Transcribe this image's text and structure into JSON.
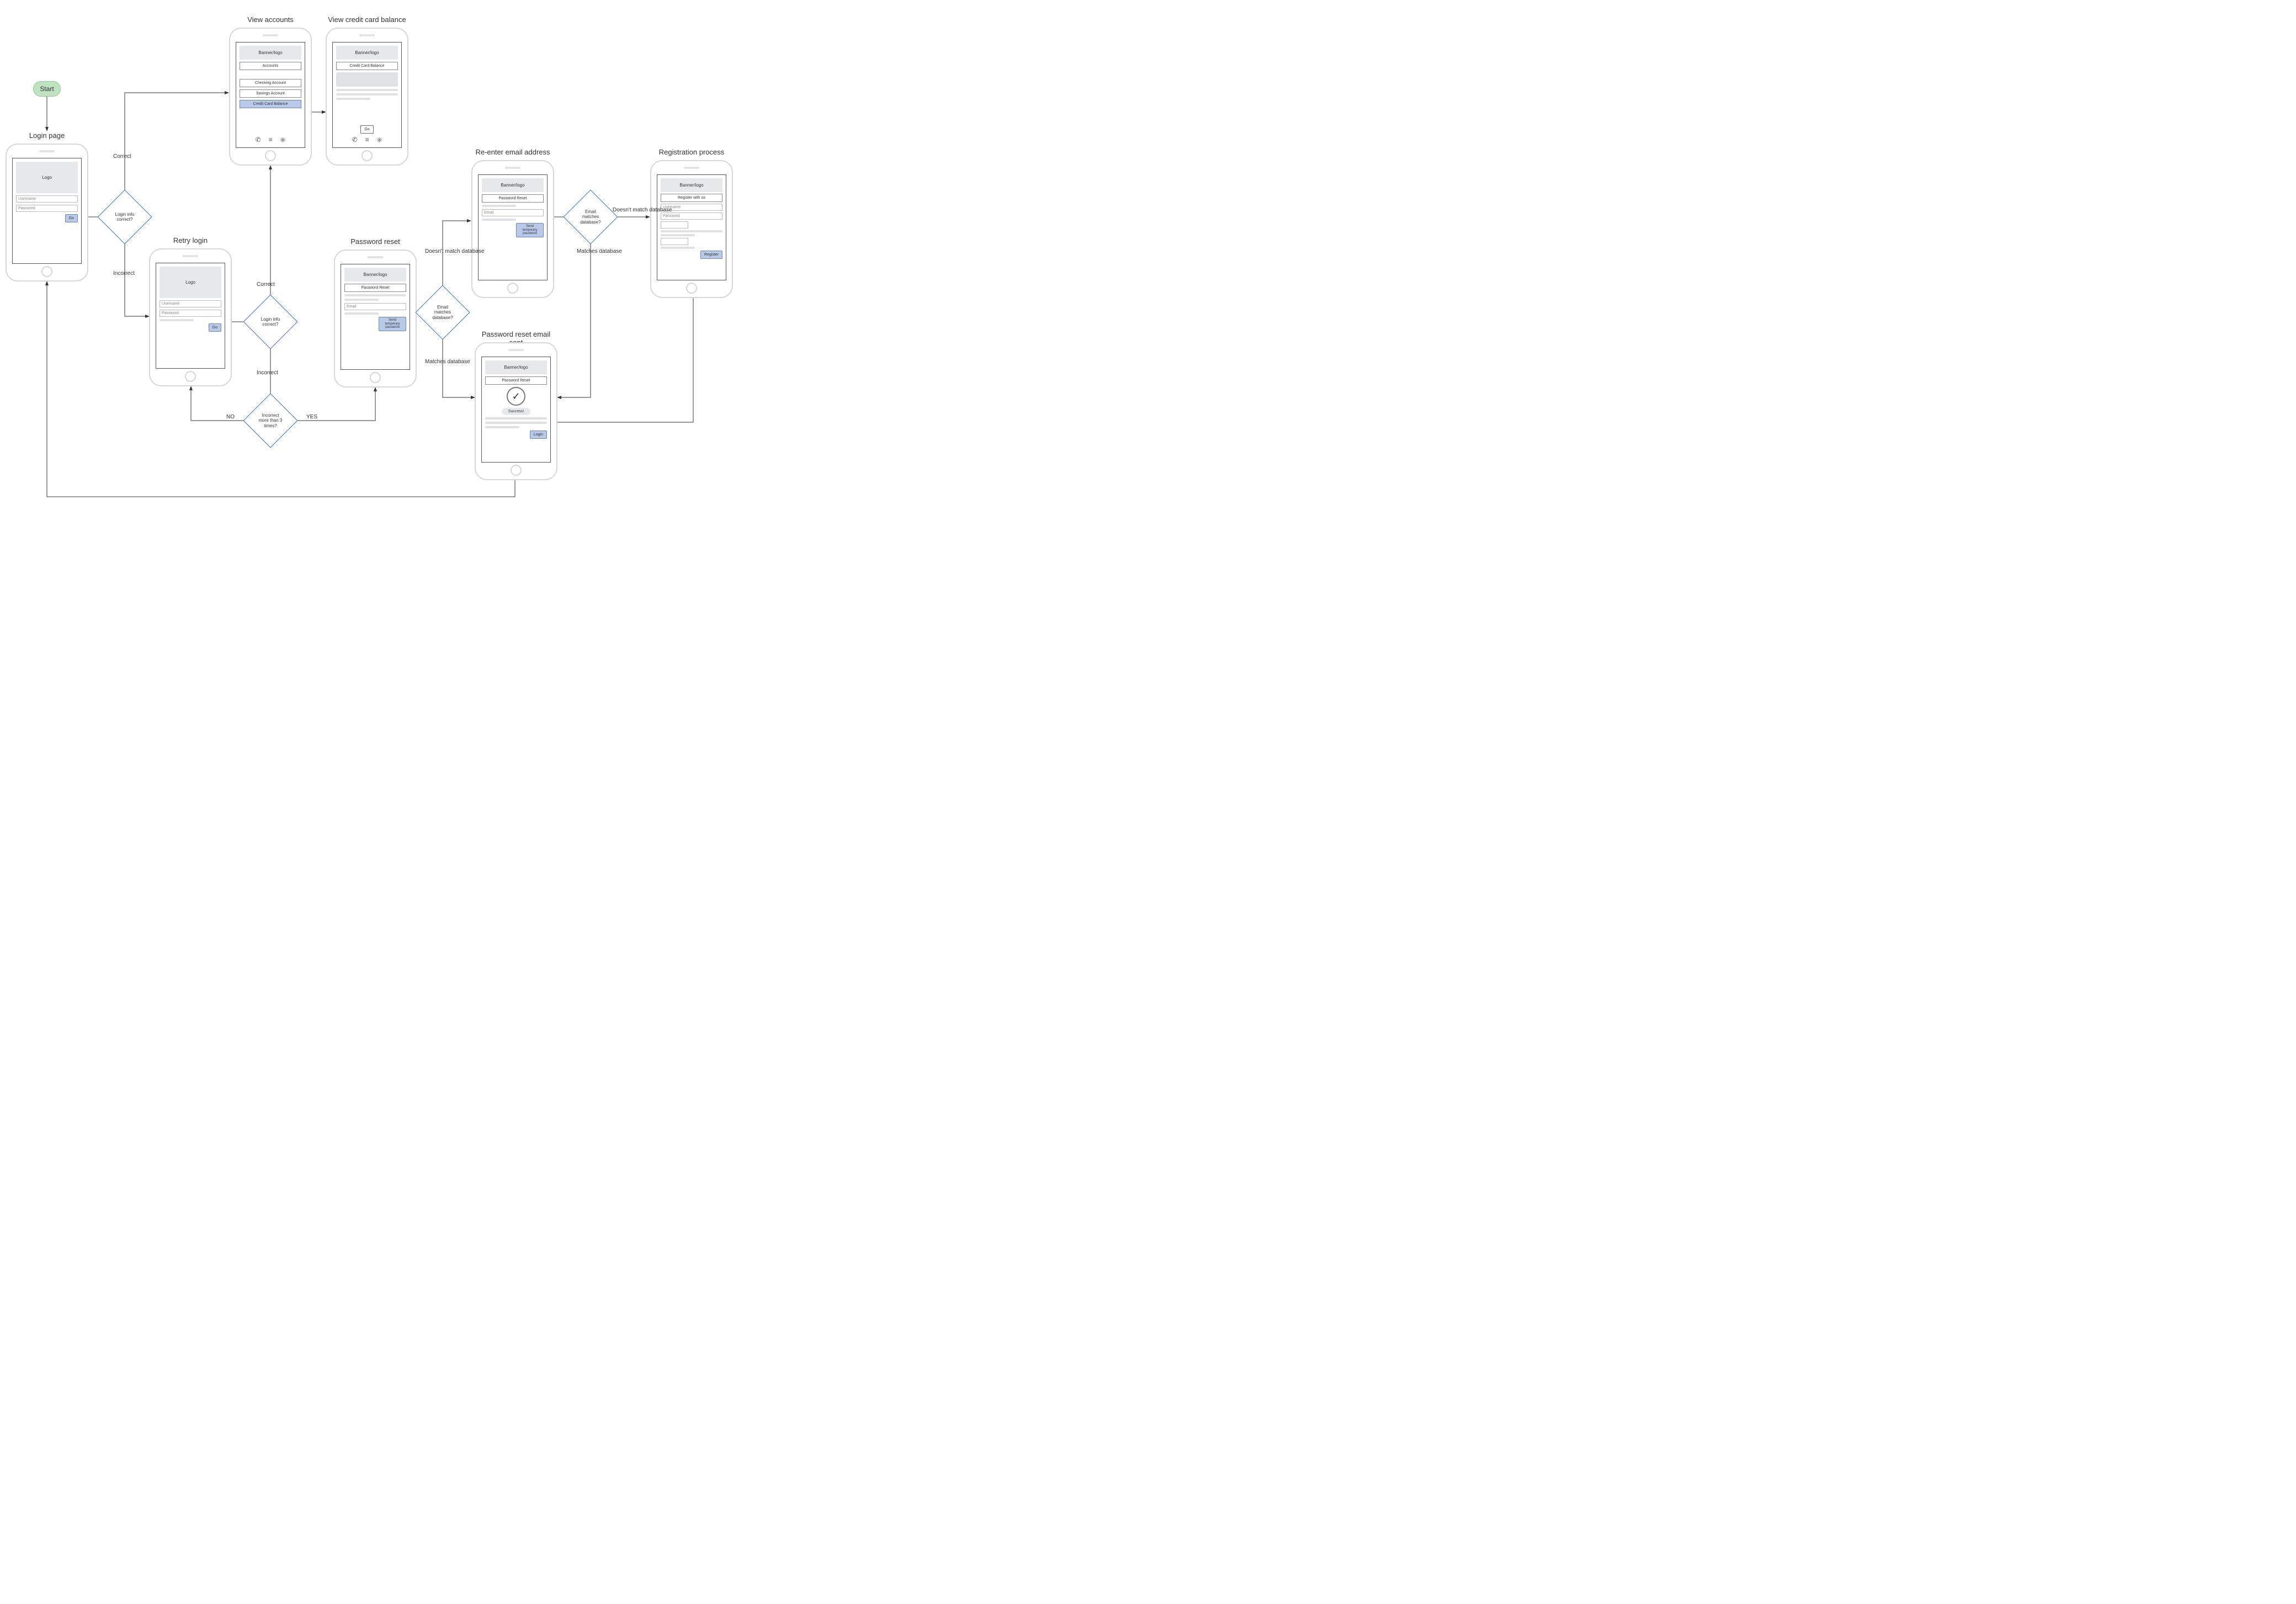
{
  "start": {
    "label": "Start"
  },
  "screens": {
    "login": {
      "title": "Login page",
      "logo": "Logo",
      "username_ph": "Username",
      "password_ph": "Password",
      "go": "Go"
    },
    "retry": {
      "title": "Retry login",
      "logo": "Logo",
      "username_ph": "Username",
      "password_ph": "Password",
      "go": "Go"
    },
    "accounts": {
      "title": "View accounts",
      "banner": "Banner/logo",
      "section": "Accounts",
      "checking": "Checking Account",
      "savings": "Savings Account",
      "cc": "Credit Card Balance"
    },
    "cc_balance": {
      "title": "View credit card balance",
      "banner": "Banner/logo",
      "section": "Credit Card Balance",
      "go": "Go"
    },
    "pw_reset": {
      "title": "Password reset",
      "banner": "Banner/logo",
      "section": "Password Reset",
      "email_ph": "Email",
      "send": "Send temporary password"
    },
    "reenter": {
      "title": "Re-enter email address",
      "banner": "Banner/logo",
      "section": "Password Reset",
      "email_ph": "Email",
      "send": "Send temporary password"
    },
    "sent": {
      "title": "Password reset email sent",
      "banner": "Banner/logo",
      "section": "Password Reset",
      "success": "Success!",
      "login_btn": "Login"
    },
    "register": {
      "title": "Registration process",
      "banner": "Banner/logo",
      "section": "Register with us",
      "username_ph": "Username",
      "password_ph": "Password",
      "register_btn": "Register"
    }
  },
  "decisions": {
    "login1": "Login info correct?",
    "login2": "Login info correct?",
    "three": "Incorrect more than 3 times?",
    "match1": "Email matches database?",
    "match2": "Email matches database?"
  },
  "edges": {
    "correct": "Correct",
    "incorrect": "Incorrect",
    "no": "NO",
    "yes": "YES",
    "matches": "Matches database",
    "nomatch": "Doesn't match database",
    "nomatch2": "Doesn't match database"
  }
}
